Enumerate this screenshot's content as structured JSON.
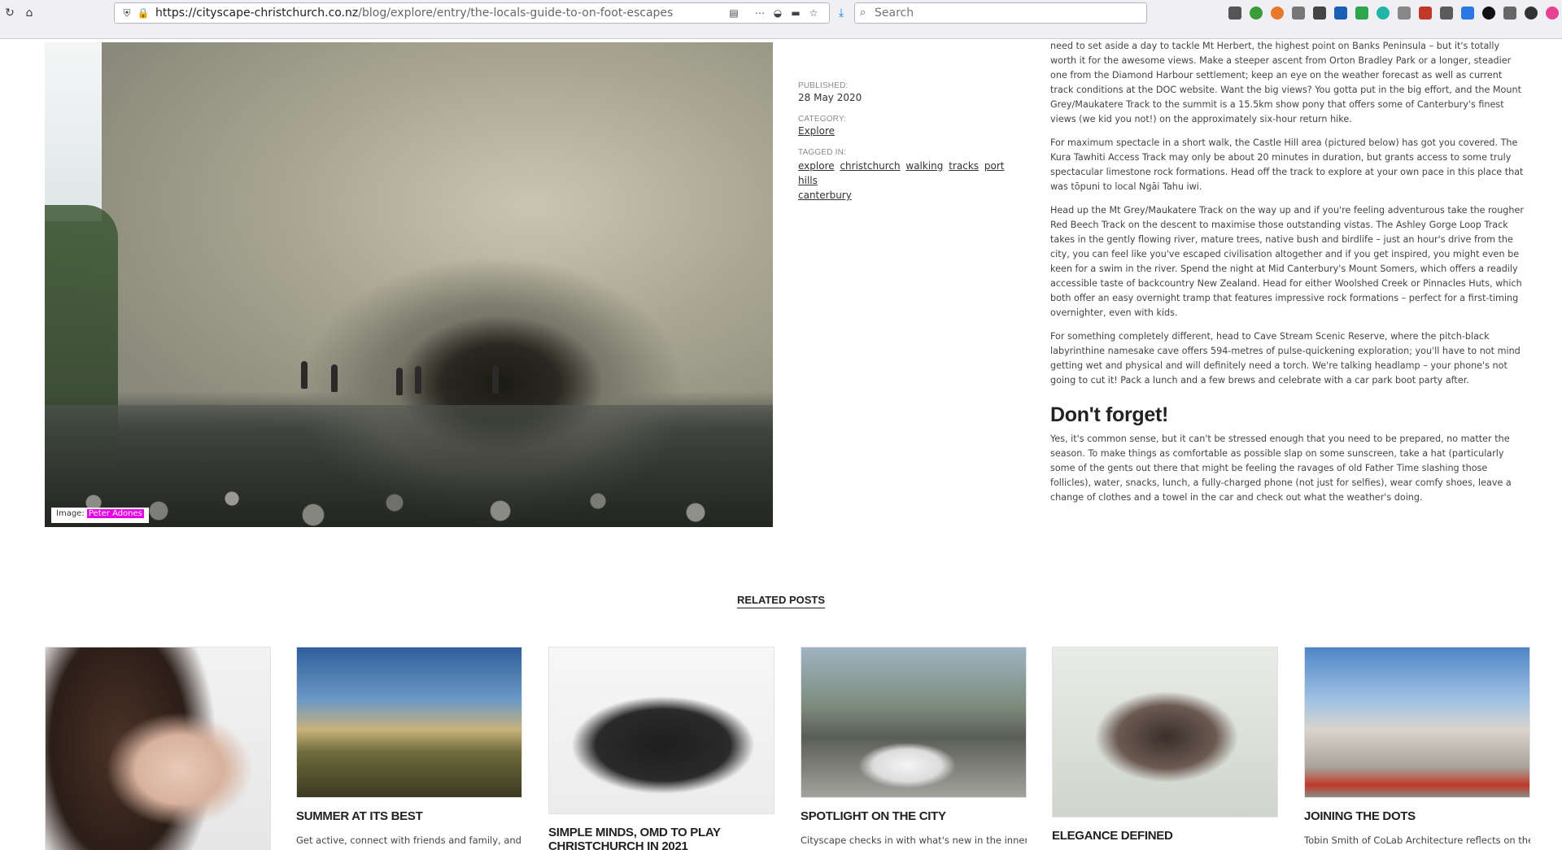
{
  "browser": {
    "url_domain": "https://cityscape-christchurch.co.nz",
    "url_path": "/blog/explore/entry/the-locals-guide-to-on-foot-escapes",
    "search_placeholder": "Search"
  },
  "hero": {
    "caption_label": "Image:",
    "caption_credit": "Peter Adones"
  },
  "meta": {
    "published_label": "Published:",
    "published_value": "28 May 2020",
    "category_label": "Category:",
    "category_value": "Explore",
    "tagged_label": "Tagged in:",
    "tags": [
      "explore",
      "christchurch",
      "walking",
      "tracks",
      "port hills",
      "canterbury"
    ]
  },
  "article": {
    "paragraphs": [
      "need to set aside a day to tackle Mt Herbert, the highest point on Banks Peninsula – but it's totally worth it for the awesome views. Make a steeper ascent from Orton Bradley Park or a longer, steadier one from the Diamond Harbour settlement; keep an eye on the weather forecast as well as current track conditions at the DOC website. Want the big views? You gotta put in the big effort, and the Mount Grey/Maukatere Track to the summit is a 15.5km show pony that offers some of Canterbury's finest views (we kid you not!) on the approximately six-hour return hike.",
      "For maximum spectacle in a short walk, the Castle Hill area (pictured below) has got you covered. The Kura Tawhiti Access Track may only be about 20 minutes in duration, but grants access to some truly spectacular limestone rock formations. Head off the track to explore at your own pace in this place that was tōpuni to local Ngāi Tahu iwi.",
      "Head up the Mt Grey/Maukatere Track on the way up and if you're feeling adventurous take the rougher Red Beech Track on the descent to maximise those outstanding vistas. The Ashley Gorge Loop Track takes in the gently flowing river, mature trees, native bush and birdlife – just an hour's drive from the city, you can feel like you've escaped civilisation altogether and if you get inspired, you might even be keen for a swim in the river. Spend the night at Mid Canterbury's Mount Somers, which offers a readily accessible taste of backcountry New Zealand. Head for either Woolshed Creek or Pinnacles Huts, which both offer an easy overnight tramp that features impressive rock formations – perfect for a first-timing overnighter, even with kids.",
      "For something completely different, head to Cave Stream Scenic Reserve, where the pitch-black labyrinthine namesake cave offers 594-metres of pulse-quickening exploration; you'll have to not mind getting wet and physical and will definitely need a torch. We're talking headlamp – your phone's not going to cut it! Pack a lunch and a few brews and celebrate with a car park boot party after."
    ],
    "heading": "Don't forget!",
    "closing": "Yes, it's common sense, but it can't be stressed enough that you need to be prepared, no matter the season. To make things as comfortable as possible slap on some sunscreen, take a hat (particularly some of the gents out there that might be feeling the ravages of old Father Time slashing those follicles), water, snacks, lunch, a fully-charged phone (not just for selfies), wear comfy shoes, leave a change of clothes and a towel in the car and check out what the weather's doing."
  },
  "related": {
    "title": "Related posts",
    "cards": [
      {
        "title": "",
        "excerpt": ""
      },
      {
        "title": "Summer at its best",
        "excerpt": "Get active, connect with friends and family, and"
      },
      {
        "title": "Simple Minds, OMD to play Christchurch in 2021",
        "excerpt": ""
      },
      {
        "title": "Spotlight on the city",
        "excerpt": "Cityscape checks in with what's new in the inner city,"
      },
      {
        "title": "Elegance defined",
        "excerpt": ""
      },
      {
        "title": "Joining the dots",
        "excerpt": "Tobin Smith of CoLab Architecture reflects on the"
      }
    ]
  },
  "colors": {
    "caption_highlight": "#e600e6",
    "toolbar_bg": "#f0f0f4"
  }
}
